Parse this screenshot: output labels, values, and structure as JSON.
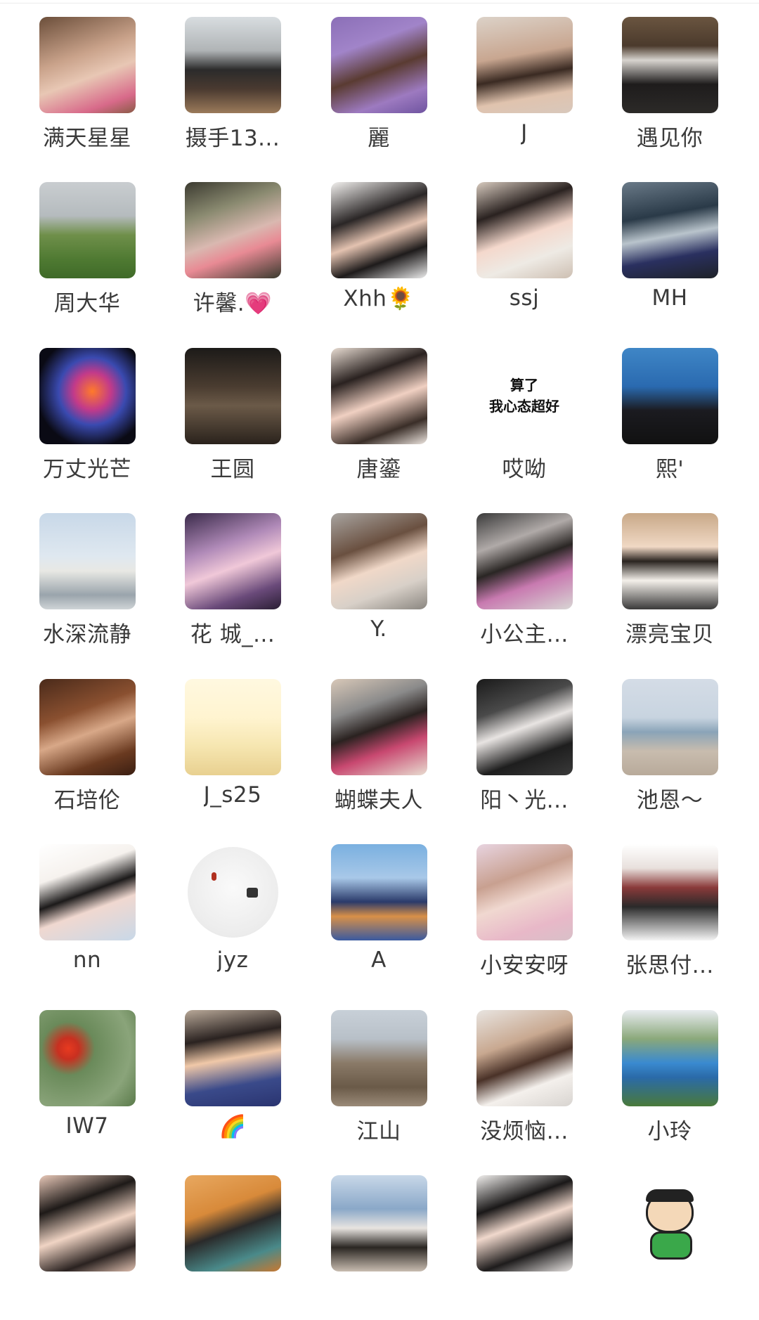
{
  "members": [
    {
      "name": "满天星星",
      "bg": "linear-gradient(160deg,#6b4e3a 0%,#c9a28a 40%,#e8c7b4 60%,#d86a8a 85%,#8a5b46 100%)"
    },
    {
      "name": "摄手13...",
      "bg": "linear-gradient(180deg,#d8dde0 0%,#b0b4b6 35%,#2b2b2b 55%,#4a3a30 75%,#9b7a5a 100%)"
    },
    {
      "name": "麗",
      "bg": "linear-gradient(160deg,#8b6fb7 0%,#a184c9 30%,#5a3b32 55%,#9d7ac0 80%,#6f54a0 100%)"
    },
    {
      "name": "J",
      "bg": "linear-gradient(170deg,#dcd2c8 0%,#c8a690 40%,#3a2a22 60%,#e0c3ae 80%,#d8c8bc 100%)"
    },
    {
      "name": "遇见你",
      "bg": "linear-gradient(180deg,#6a5540 0%,#4b3a2c 30%,#d8d4cf 45%,#1e1c1c 70%,#2c2a28 100%)"
    },
    {
      "name": "周大华",
      "bg": "linear-gradient(180deg,#c9cdd0 0%,#b5bbbe 35%,#6f8f4a 55%,#4f7a32 80%,#3f6a28 100%)"
    },
    {
      "name": "许馨.💗",
      "bg": "linear-gradient(160deg,#3b3a30 0%,#8a8a70 30%,#d9b8b0 55%,#e88a94 70%,#3a3a2e 100%)"
    },
    {
      "name": "Xhh🌻",
      "bg": "linear-gradient(160deg,#f2f0ee 0%,#2a2626 35%,#e3c2b0 55%,#1e1b1b 75%,#ececec 100%)"
    },
    {
      "name": "ssj",
      "bg": "linear-gradient(160deg,#d8cbbf 0%,#2a2220 30%,#f4d8cc 55%,#eeeae4 75%,#cdbfb2 100%)"
    },
    {
      "name": "MH",
      "bg": "linear-gradient(170deg,#6a7a88 0%,#2a3a48 35%,#b9c4cc 55%,#2a3060 75%,#1e2228 100%)"
    },
    {
      "name": "万丈光芒",
      "bg": "radial-gradient(circle at 55% 45%,#ff7a2a 0%,#c23a8a 25%,#3a4ab0 45%,#0a0a14 75%)"
    },
    {
      "name": "王圆",
      "bg": "linear-gradient(180deg,#1c1a18 0%,#4a3c30 40%,#6b5a48 60%,#2a221c 100%)"
    },
    {
      "name": "唐鎏",
      "bg": "linear-gradient(160deg,#e8dcd2 0%,#2a2220 30%,#f0d0c2 55%,#3a2e28 80%,#eee6e0 100%)"
    },
    {
      "name": "哎呦",
      "bg": "#ffffff",
      "text_art_line1": "算了",
      "text_art_line2": "我心态超好"
    },
    {
      "name": "熙'",
      "bg": "linear-gradient(180deg,#3f86c6 0%,#2a6ab0 40%,#1b1b20 65%,#111 100%)"
    },
    {
      "name": "水深流静",
      "bg": "linear-gradient(180deg,#c8d8e8 0%,#dfe8f0 45%,#e8e8e4 60%,#9aa4ac 85%,#cfd4d6 100%)"
    },
    {
      "name": "花 城_...",
      "bg": "linear-gradient(160deg,#3a2a4a 0%,#b08ab8 35%,#f0c8d8 55%,#6a4a7a 80%,#2a1e34 100%)"
    },
    {
      "name": "Y.",
      "bg": "linear-gradient(160deg,#a8a4a0 0%,#6a5040 35%,#f0d8c8 55%,#d8d0c8 75%,#8a8680 100%)"
    },
    {
      "name": "小公主...",
      "bg": "linear-gradient(160deg,#3a3a3a 0%,#b0aaa8 30%,#2a2624 50%,#c87ab0 70%,#d8d6d4 100%)"
    },
    {
      "name": "漂亮宝贝",
      "bg": "linear-gradient(180deg,#c8a888 0%,#f0d8c4 35%,#2a2420 50%,#f4f0ea 70%,#3a3a3a 100%)"
    },
    {
      "name": "石培伦",
      "bg": "linear-gradient(160deg,#4a2a1a 0%,#8a5030 35%,#d8a888 55%,#6a3a20 80%,#3a1e12 100%)"
    },
    {
      "name": "J_s25",
      "bg": "linear-gradient(180deg,#fff8e0 0%,#fff4d0 40%,#f6e6b0 70%,#e8d090 100%)"
    },
    {
      "name": "蝴蝶夫人",
      "bg": "linear-gradient(160deg,#d8c8b8 0%,#8a8a8a 30%,#2a2220 50%,#c84870 70%,#e8dcd0 100%)"
    },
    {
      "name": "阳丶光...",
      "bg": "linear-gradient(160deg,#1a1a1a 0%,#4a4a4a 30%,#e8e4e2 50%,#1e1e1e 75%,#3a3a3a 100%)"
    },
    {
      "name": "池恩～",
      "bg": "linear-gradient(180deg,#d4dce6 0%,#c8d4e0 40%,#8aa4b8 55%,#c8bcae 75%,#b8aa9a 100%)"
    },
    {
      "name": "nn",
      "bg": "linear-gradient(160deg,#ffffff 0%,#f6f2ee 30%,#1c1a1a 50%,#f0d8d0 65%,#c8d8e8 100%)"
    },
    {
      "name": "jyz",
      "bg": "#ffffff",
      "round": true
    },
    {
      "name": "A",
      "bg": "linear-gradient(180deg,#7ab0e0 0%,#a8c8e8 35%,#2a3a6a 60%,#d89048 75%,#3a5aa0 100%)"
    },
    {
      "name": "小安安呀",
      "bg": "linear-gradient(160deg,#e8d4e0 0%,#c8a090 35%,#f0d8d0 55%,#e8b8c8 80%,#d8c0c8 100%)"
    },
    {
      "name": "张思付...",
      "bg": "linear-gradient(180deg,#ffffff 0%,#e8e0dc 25%,#8a3a3a 45%,#2a2a2a 65%,#f4f4f4 100%)"
    },
    {
      "name": "IW7",
      "bg": "radial-gradient(circle at 30% 40%,#e83a20 0%,#c83020 12%,#6a8a5a 30%,#8aa47a 70%,#5a7a4a 100%)"
    },
    {
      "name": "🌈",
      "bg": "linear-gradient(170deg,#b8a898 0%,#2a2220 30%,#f0c8a8 50%,#3a4a8a 75%,#2a3470 100%)"
    },
    {
      "name": "江山",
      "bg": "linear-gradient(180deg,#c8d0d8 0%,#b8c0c8 30%,#8a7a68 55%,#6a5a48 80%,#9a8a78 100%)"
    },
    {
      "name": "没烦恼...",
      "bg": "linear-gradient(160deg,#e8e4e0 0%,#c8a890 35%,#4a3228 55%,#f4f0ec 75%,#d8d4d0 100%)"
    },
    {
      "name": "小玲",
      "bg": "linear-gradient(180deg,#e8ecf0 0%,#8aa87a 30%,#3a8ad0 55%,#2a6aa8 70%,#4a7a3a 100%)"
    },
    {
      "name": "",
      "bg": "linear-gradient(160deg,#e8c8b8 0%,#1e1a18 30%,#f0d4c4 55%,#2a2220 80%,#e0c0b0 100%)"
    },
    {
      "name": "",
      "bg": "linear-gradient(160deg,#e8a860 0%,#d88a3a 35%,#2a2a2a 55%,#4a8a8a 80%,#c87830 100%)"
    },
    {
      "name": "",
      "bg": "linear-gradient(180deg,#c8d8e8 0%,#8aa8c8 35%,#e8e4e0 55%,#2a2622 75%,#c8bcb0 100%)"
    },
    {
      "name": "",
      "bg": "linear-gradient(160deg,#f2f0ee 0%,#1a1818 30%,#f0d8cc 50%,#1e1c1c 75%,#e8e4e2 100%)"
    },
    {
      "name": "",
      "bg": "#ffffff",
      "cartoon": true
    }
  ]
}
